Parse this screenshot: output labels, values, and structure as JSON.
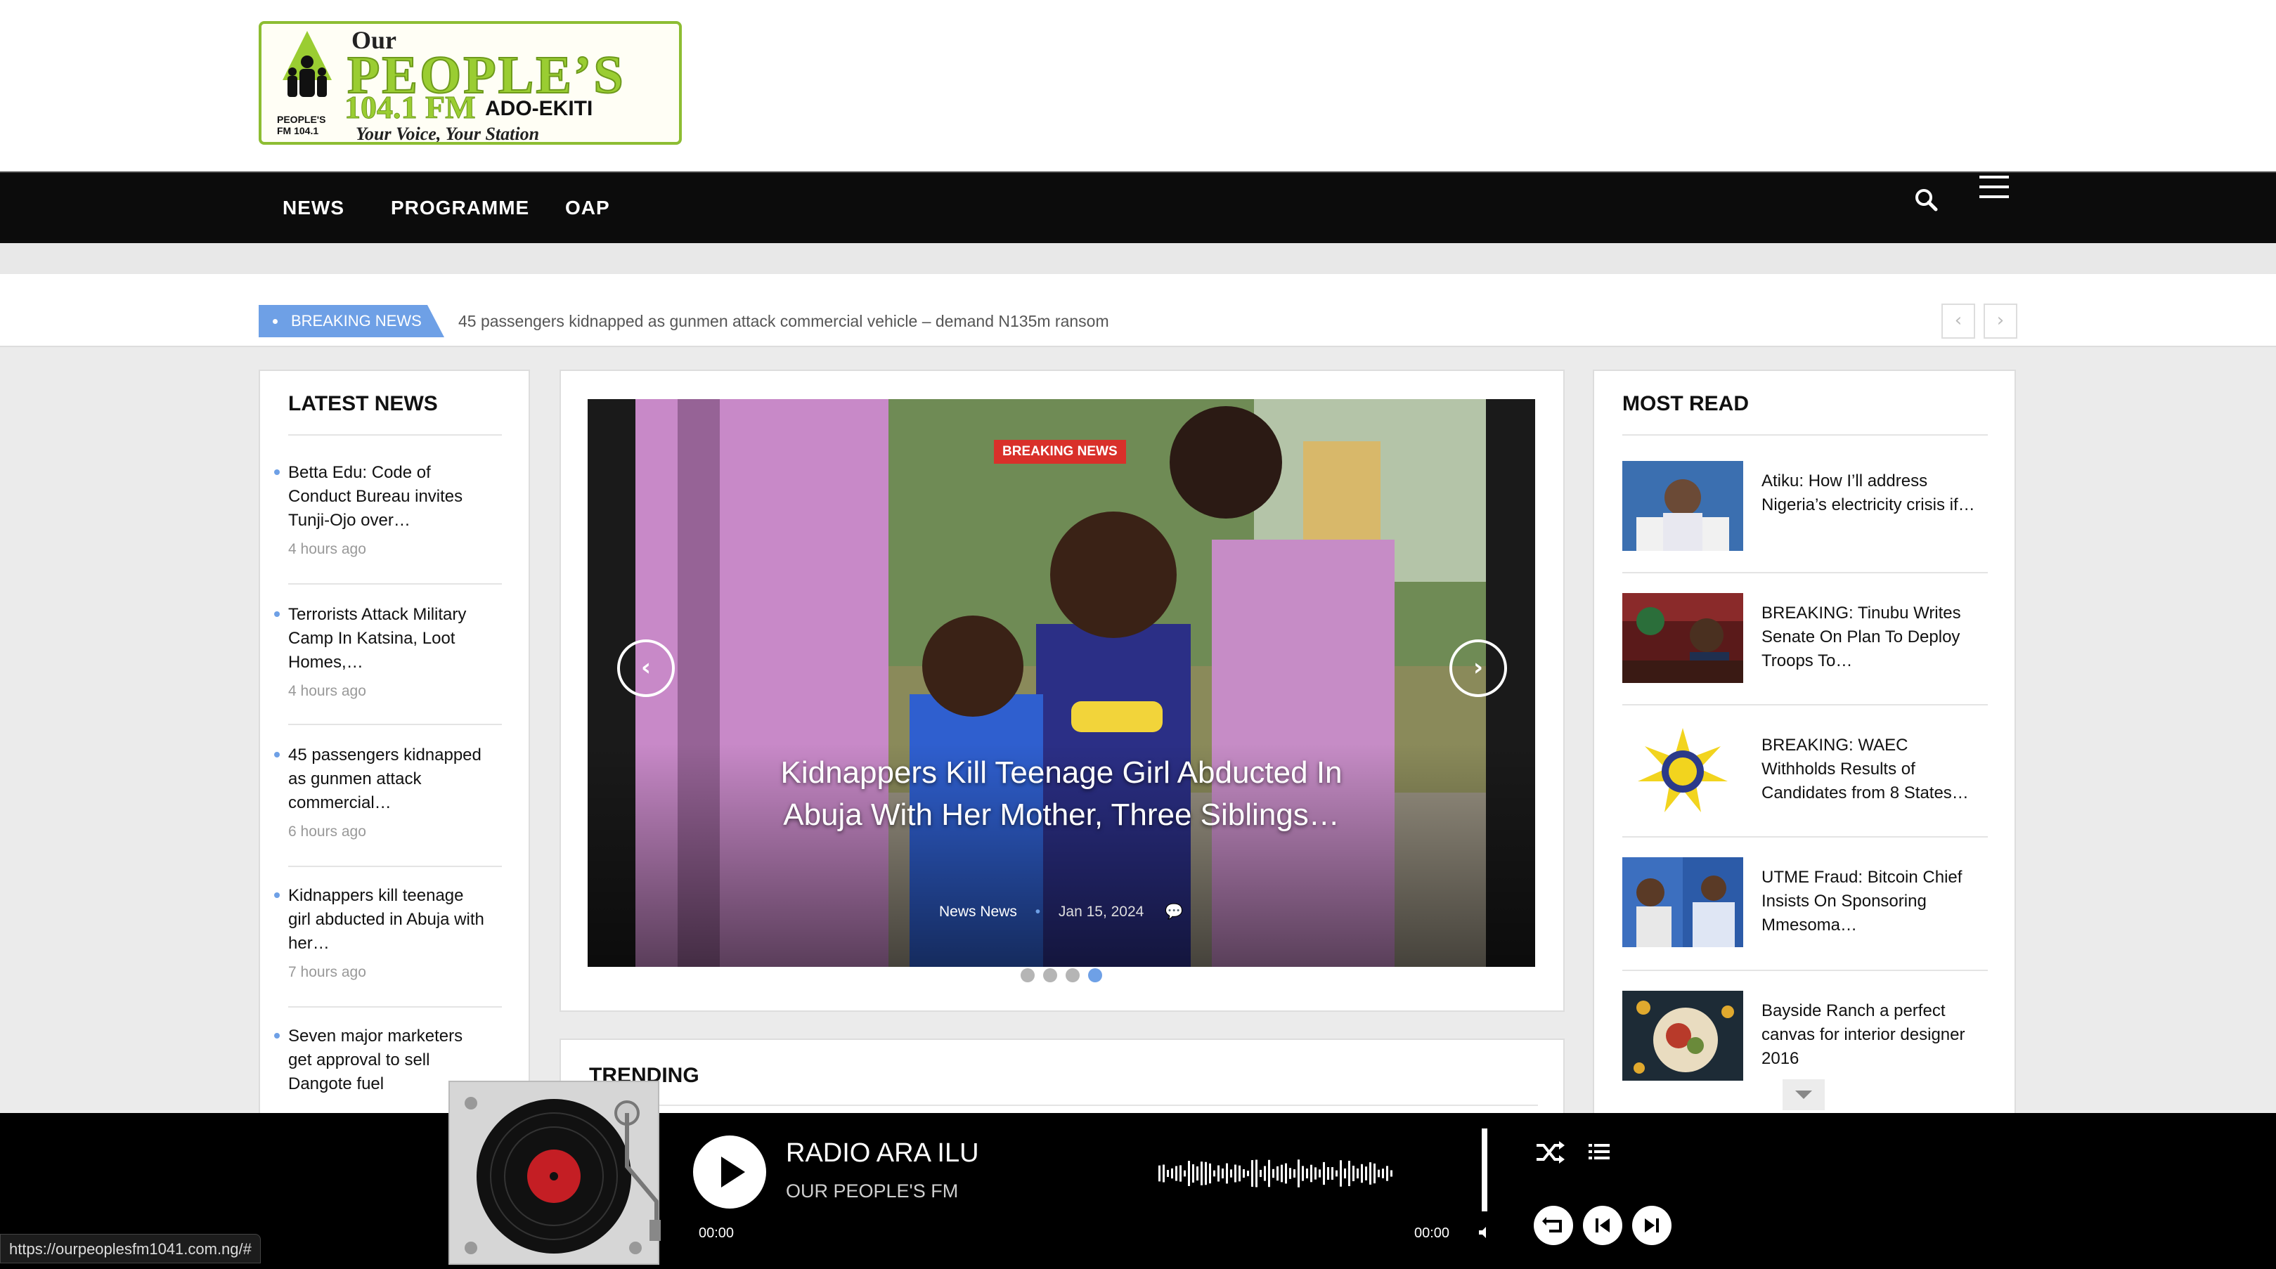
{
  "logo": {
    "our": "Our",
    "peoples": "PEOPLE’S",
    "freq": "104.1 FM",
    "city": "ADO-EKITI",
    "tagline": "Your Voice, Your Station",
    "mini": "PEOPLE'S FM 104.1"
  },
  "nav": {
    "items": [
      "NEWS",
      "PROGRAMME",
      "OAP"
    ]
  },
  "breaking": {
    "badge": "BREAKING NEWS",
    "text": "45 passengers kidnapped as gunmen attack commercial vehicle – demand N135m ransom",
    "prev": "‹",
    "next": "›"
  },
  "latest": {
    "title": "LATEST NEWS",
    "items": [
      {
        "title": "Betta Edu: Code of Conduct Bureau invites Tunji-Ojo over…",
        "time": "4 hours ago"
      },
      {
        "title": "Terrorists Attack Military Camp In Katsina, Loot Homes,…",
        "time": "4 hours ago"
      },
      {
        "title": "45 passengers kidnapped as gunmen attack commercial…",
        "time": "6 hours ago"
      },
      {
        "title": "Kidnappers kill teenage girl abducted in Abuja with her…",
        "time": "7 hours ago"
      },
      {
        "title": "Seven major marketers get approval to sell Dangote fuel",
        "time": ""
      }
    ]
  },
  "slider": {
    "category": "BREAKING NEWS",
    "headline": "Kidnappers Kill Teenage Girl Abducted In Abuja With Her Mother, Three Siblings…",
    "meta_cat": "News News",
    "meta_date": "Jan 15, 2024",
    "active_dot": 4,
    "dot_count": 4
  },
  "trending": {
    "title": "TRENDING"
  },
  "mostread": {
    "title": "MOST READ",
    "items": [
      {
        "title": "Atiku: How I’ll address Nigeria’s electricity crisis if…"
      },
      {
        "title": "BREAKING: Tinubu Writes Senate On Plan To Deploy Troops To…"
      },
      {
        "title": "BREAKING: WAEC Withholds Results of Candidates from 8 States…"
      },
      {
        "title": "UTME Fraud: Bitcoin Chief Insists On Sponsoring Mmesoma…"
      },
      {
        "title": "Bayside Ranch a perfect canvas for interior designer 2016"
      }
    ]
  },
  "player": {
    "station": "RADIO ARA ILU",
    "subtitle": "OUR PEOPLE'S FM",
    "time_start": "00:00",
    "time_end": "00:00"
  },
  "status": {
    "url": "https://ourpeoplesfm1041.com.ng/#"
  },
  "colors": {
    "accent": "#6ea0e6",
    "breaking_red": "#d9302a",
    "nav_bg": "#0c0c0c",
    "logo_green": "#9acd32"
  }
}
